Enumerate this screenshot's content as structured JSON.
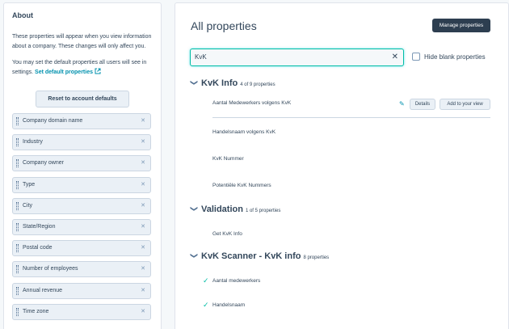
{
  "sidebar": {
    "title": "About",
    "description": "These properties will appear when you view information about a company. These changes will only affect you.",
    "default_text": "You may set the default properties all users will see in settings.",
    "default_link": "Set default properties",
    "reset_button": "Reset to account defaults",
    "properties": [
      {
        "label": "Company domain name"
      },
      {
        "label": "Industry"
      },
      {
        "label": "Company owner"
      },
      {
        "label": "Type"
      },
      {
        "label": "City"
      },
      {
        "label": "State/Region"
      },
      {
        "label": "Postal code"
      },
      {
        "label": "Number of employees"
      },
      {
        "label": "Annual revenue"
      },
      {
        "label": "Time zone"
      }
    ]
  },
  "main": {
    "title": "All properties",
    "manage_button": "Manage properties",
    "search_value": "KvK",
    "hide_blank_label": "Hide blank properties",
    "sections": [
      {
        "name": "KvK Info",
        "count": "4 of 9 properties",
        "properties": [
          {
            "label": "Aantal Medewerkers volgens KvK"
          },
          {
            "label": "Handelsnaam volgens KvK"
          },
          {
            "label": "KvK Nummer"
          },
          {
            "label": "Potentiële KvK Nummers"
          }
        ],
        "row_actions": {
          "details": "Details",
          "add": "Add to your view"
        }
      },
      {
        "name": "Validation",
        "count": "1 of 5 properties",
        "properties": [
          {
            "label": "Get KvK Info"
          }
        ]
      },
      {
        "name": "KvK Scanner - KvK info",
        "count": "8 properties",
        "properties": [
          {
            "label": "Aantal medewerkers",
            "checked": true
          },
          {
            "label": "Handelsnaam",
            "checked": true
          }
        ]
      }
    ]
  },
  "colors": {
    "accent_teal": "#00bda5",
    "link_blue": "#0091ae",
    "dark_button": "#2d3e50",
    "text": "#33475b"
  }
}
